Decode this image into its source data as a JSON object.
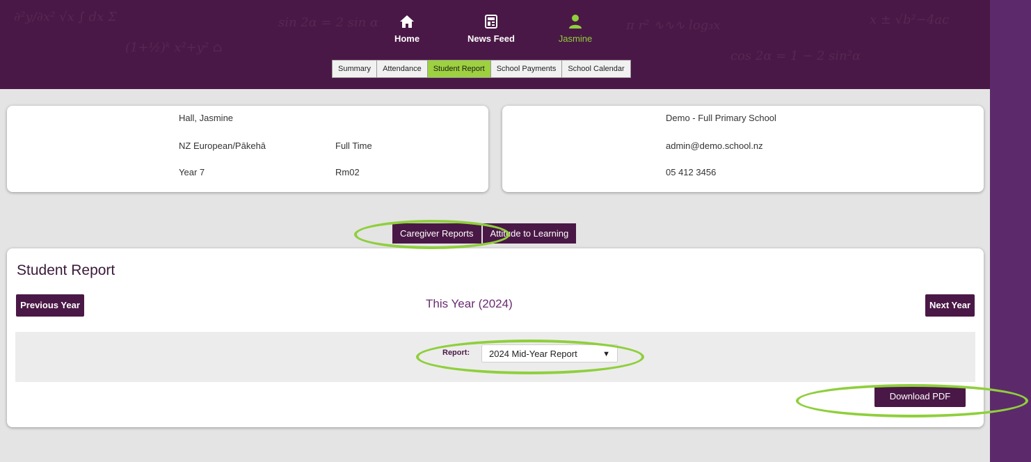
{
  "nav": {
    "home_label": "Home",
    "newsfeed_label": "News Feed",
    "user_label": "Jasmine",
    "home_icon": "home-icon",
    "newsfeed_icon": "newspaper-icon",
    "user_icon": "user-icon"
  },
  "tabs": [
    "Summary",
    "Attendance",
    "Student Report",
    "School Payments",
    "School Calendar"
  ],
  "active_tab": "Student Report",
  "student": {
    "name": "Hall, Jasmine",
    "ethnicity": "NZ European/Pākehā",
    "attendance_type": "Full Time",
    "year": "Year 7",
    "room": "Rm02"
  },
  "school": {
    "name": "Demo - Full Primary School",
    "email": "admin@demo.school.nz",
    "phone": "05 412 3456"
  },
  "subtabs": [
    "Caregiver Reports",
    "Attitude to Learning"
  ],
  "report": {
    "title": "Student Report",
    "prev_label": "Previous Year",
    "year_label": "This Year (2024)",
    "next_label": "Next Year",
    "select_label": "Report:",
    "select_value": "2024 Mid-Year Report",
    "download_label": "Download PDF"
  },
  "colors": {
    "brand": "#4a1846",
    "accent": "#9dd13f",
    "highlight_ring": "#8fcf3c",
    "outer_bg": "#5c2a6a"
  }
}
